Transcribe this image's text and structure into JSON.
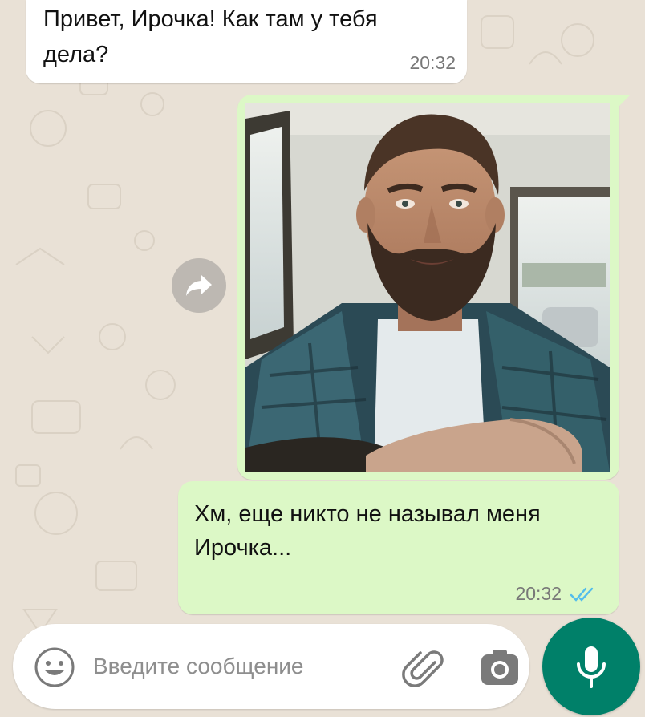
{
  "chat": {
    "messages": [
      {
        "direction": "incoming",
        "text": "Привет, Ирочка! Как там у тебя дела?",
        "time": "20:32"
      },
      {
        "direction": "outgoing",
        "type": "photo",
        "content": "man-with-beard-in-car"
      },
      {
        "direction": "outgoing",
        "text": "Хм, еще никто не называл меня Ирочка...",
        "time": "20:32",
        "status": "read"
      }
    ]
  },
  "composer": {
    "placeholder": "Введите сообщение",
    "value": ""
  },
  "icons": {
    "forward": "forward-icon",
    "emoji": "emoji-icon",
    "attach": "paperclip-icon",
    "camera": "camera-icon",
    "mic": "microphone-icon",
    "read_receipt": "double-check-icon"
  },
  "colors": {
    "wallpaper": "#e9e1d6",
    "incoming_bubble": "#ffffff",
    "outgoing_bubble": "#dcf8c6",
    "accent": "#008069",
    "read_tick": "#53bdeb"
  }
}
